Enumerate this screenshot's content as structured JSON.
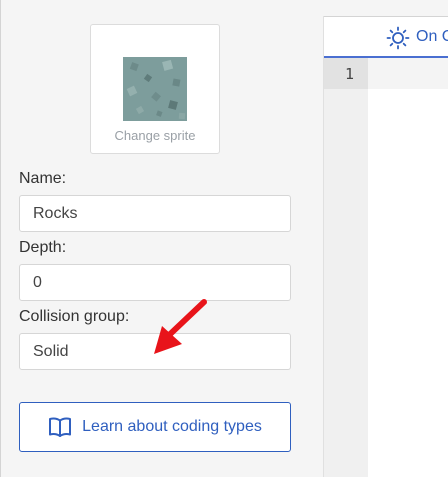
{
  "sprite": {
    "caption": "Change sprite",
    "thumbnail_icon": "rock-tile-sprite"
  },
  "fields": {
    "name_label": "Name:",
    "name_value": "Rocks",
    "depth_label": "Depth:",
    "depth_value": "0",
    "collision_label": "Collision group:",
    "collision_value": "Solid"
  },
  "learn_button": {
    "label": "Learn about coding types",
    "icon": "open-book-icon"
  },
  "editor": {
    "tab_label": "On C",
    "tab_icon": "sun-icon",
    "line_numbers": [
      "1"
    ]
  },
  "annotation": {
    "arrow_color": "#e8141a"
  },
  "colors": {
    "accent": "#2f5fbf",
    "panel_bg": "#f5f5f5"
  }
}
